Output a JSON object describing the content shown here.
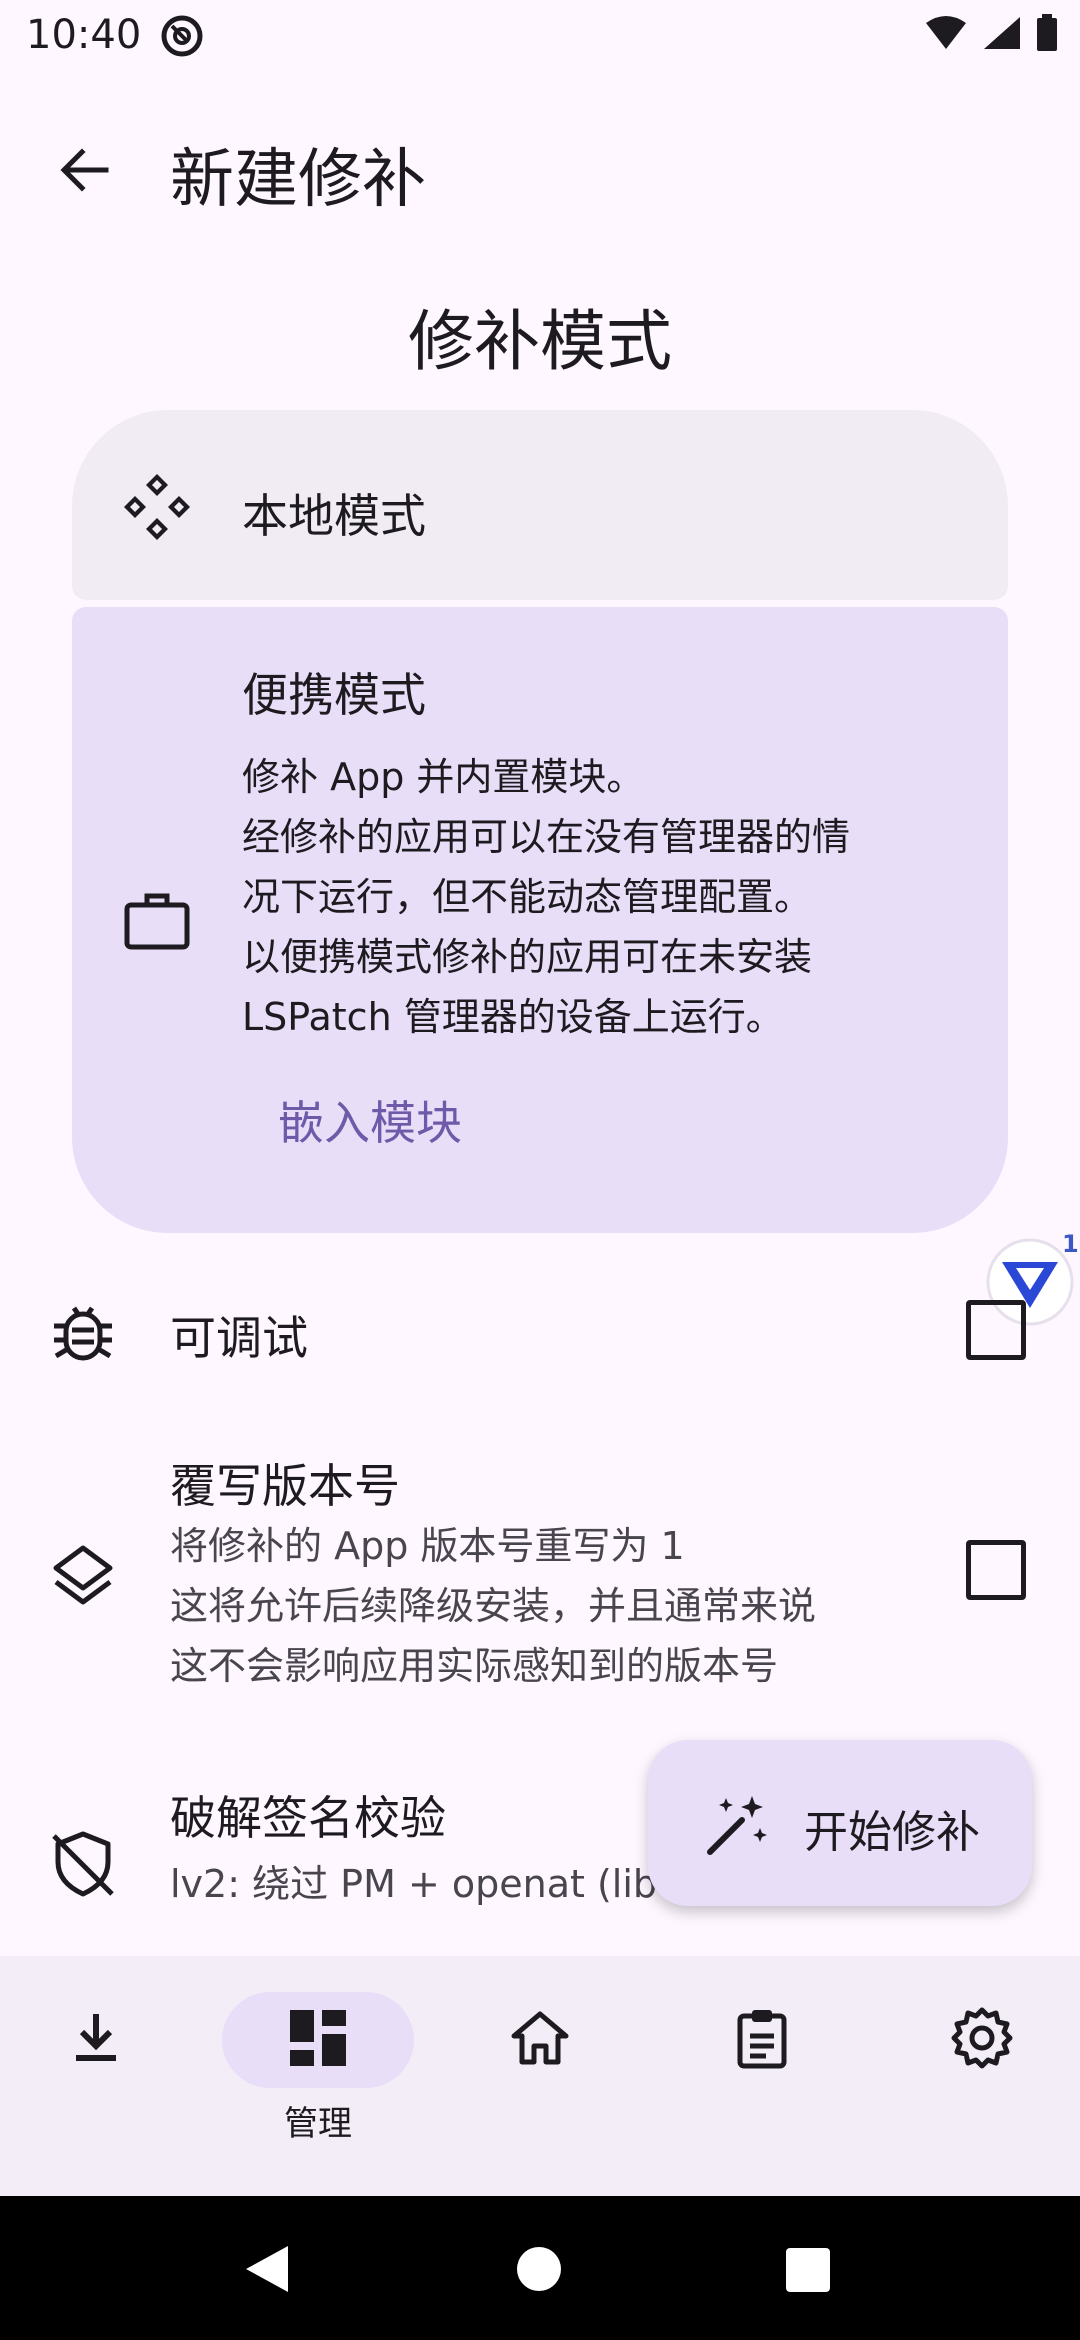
{
  "status": {
    "time": "10:40"
  },
  "header": {
    "title": "新建修补"
  },
  "patch_mode": {
    "section_title": "修补模式",
    "local": {
      "label": "本地模式"
    },
    "portable": {
      "label": "便携模式",
      "desc_lines": [
        "修补 App 并内置模块。",
        "经修补的应用可以在没有管理器的情",
        "况下运行，但不能动态管理配置。",
        "以便携模式修补的应用可在未安装",
        "LSPatch 管理器的设备上运行。"
      ],
      "embed_button": "嵌入模块"
    }
  },
  "options": {
    "debuggable": {
      "title": "可调试",
      "checked": false
    },
    "override_version": {
      "title": "覆写版本号",
      "sub_lines": [
        "将修补的 App 版本号重写为 1",
        "这将允许后续降级安装，并且通常来说",
        "这不会影响应用实际感知到的版本号"
      ],
      "checked": false
    },
    "sig_bypass": {
      "title": "破解签名校验",
      "sub": "lv2: 绕过 PM + openat (lib"
    }
  },
  "floating": {
    "badge": "1"
  },
  "fab": {
    "label": "开始修补"
  },
  "bottom_nav": {
    "items": [
      {
        "icon": "download-icon"
      },
      {
        "icon": "dashboard-icon",
        "label": "管理",
        "selected": true
      },
      {
        "icon": "home-icon"
      },
      {
        "icon": "clipboard-icon"
      },
      {
        "icon": "settings-icon"
      }
    ]
  },
  "colors": {
    "background": "#FEF7FF",
    "card_local": "#F1ECF4",
    "card_portable": "#E8DEF8",
    "accent_text": "#6E5AA8",
    "nav_bar": "#F3EDF7"
  }
}
